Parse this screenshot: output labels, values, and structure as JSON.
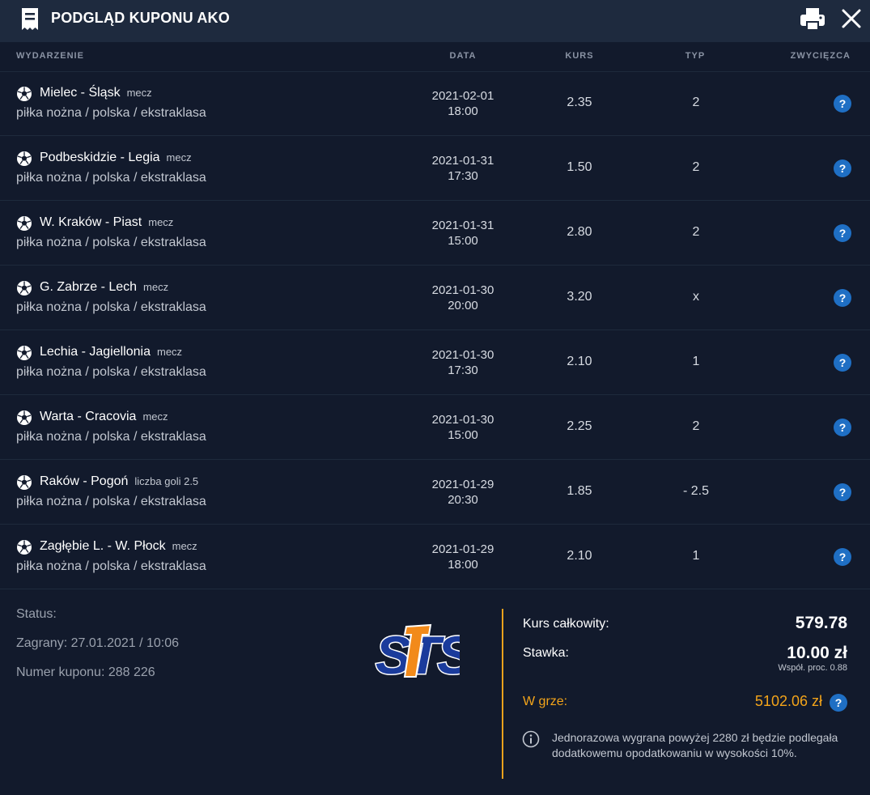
{
  "header": {
    "title": "PODGLĄD KUPONU AKO"
  },
  "columns": {
    "event": "WYDARZENIE",
    "date": "DATA",
    "odds": "KURS",
    "type": "TYP",
    "winner": "ZWYCIĘZCA"
  },
  "rows": [
    {
      "name": "Mielec - Śląsk",
      "market": "mecz",
      "path": "piłka nożna / polska / ekstraklasa",
      "date": "2021-02-01",
      "time": "18:00",
      "odds": "2.35",
      "type": "2",
      "winner": "?"
    },
    {
      "name": "Podbeskidzie - Legia",
      "market": "mecz",
      "path": "piłka nożna / polska / ekstraklasa",
      "date": "2021-01-31",
      "time": "17:30",
      "odds": "1.50",
      "type": "2",
      "winner": "?"
    },
    {
      "name": "W. Kraków - Piast",
      "market": "mecz",
      "path": "piłka nożna / polska / ekstraklasa",
      "date": "2021-01-31",
      "time": "15:00",
      "odds": "2.80",
      "type": "2",
      "winner": "?"
    },
    {
      "name": "G. Zabrze - Lech",
      "market": "mecz",
      "path": "piłka nożna / polska / ekstraklasa",
      "date": "2021-01-30",
      "time": "20:00",
      "odds": "3.20",
      "type": "x",
      "winner": "?"
    },
    {
      "name": "Lechia - Jagiellonia",
      "market": "mecz",
      "path": "piłka nożna / polska / ekstraklasa",
      "date": "2021-01-30",
      "time": "17:30",
      "odds": "2.10",
      "type": "1",
      "winner": "?"
    },
    {
      "name": "Warta - Cracovia",
      "market": "mecz",
      "path": "piłka nożna / polska / ekstraklasa",
      "date": "2021-01-30",
      "time": "15:00",
      "odds": "2.25",
      "type": "2",
      "winner": "?"
    },
    {
      "name": "Raków - Pogoń",
      "market": "liczba goli 2.5",
      "path": "piłka nożna / polska / ekstraklasa",
      "date": "2021-01-29",
      "time": "20:30",
      "odds": "1.85",
      "type": "- 2.5",
      "winner": "?"
    },
    {
      "name": "Zagłębie L. - W. Płock",
      "market": "mecz",
      "path": "piłka nożna / polska / ekstraklasa",
      "date": "2021-01-29",
      "time": "18:00",
      "odds": "2.10",
      "type": "1",
      "winner": "?"
    }
  ],
  "footer": {
    "status_label": "Status:",
    "played": "Zagrany: 27.01.2021 / 10:06",
    "coupon_number": "Numer kuponu: 288 226",
    "logo_text": "STS",
    "total_odds_label": "Kurs całkowity:",
    "total_odds_value": "579.78",
    "stake_label": "Stawka:",
    "stake_value": "10.00 zł",
    "stake_note": "Współ. proc. 0.88",
    "in_game_label": "W grze:",
    "in_game_value": "5102.06 zł",
    "in_game_help": "?",
    "tax_note": "Jednorazowa wygrana powyżej 2280 zł będzie podlegała dodatkowemu opodatkowaniu w wysokości 10%."
  },
  "colors": {
    "background": "#121a2c",
    "header": "#1e2a3e",
    "accent_orange": "#f3a41a",
    "help_blue": "#1f6fc4",
    "logo_blue": "#1a3b9c"
  },
  "icons": {
    "header_left": "receipt-icon",
    "print": "printer-icon",
    "close": "close-icon",
    "sport": "soccer-ball-icon",
    "help": "question-icon",
    "info": "info-icon"
  }
}
